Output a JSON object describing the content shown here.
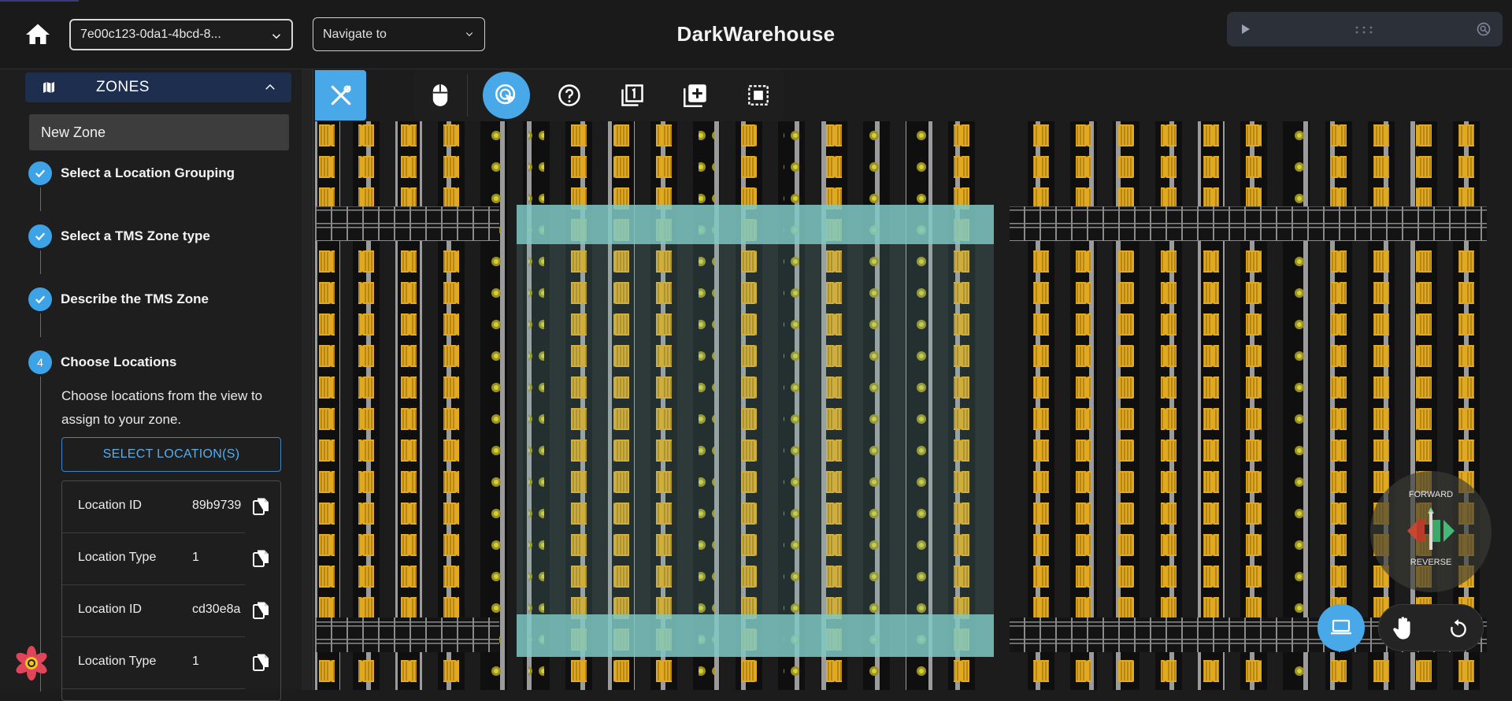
{
  "header": {
    "app_title": "DarkWarehouse",
    "warehouse_select": {
      "value": "7e00c123-0da1-4bcd-8..."
    },
    "navigate_select": {
      "value": "Navigate to"
    }
  },
  "sidebar": {
    "section_title": "ZONES",
    "zone_name": "New Zone",
    "steps": [
      {
        "number": "1",
        "label": "Select a Location Grouping",
        "state": "complete"
      },
      {
        "number": "2",
        "label": "Select a TMS Zone type",
        "state": "complete"
      },
      {
        "number": "3",
        "label": "Describe the TMS Zone",
        "state": "complete"
      },
      {
        "number": "4",
        "label": "Choose Locations",
        "state": "active"
      }
    ],
    "step4_description": "Choose locations from the view to assign to your zone.",
    "select_button_label": "SELECT LOCATION(S)",
    "locations": [
      {
        "key": "Location ID",
        "value": "89b9739"
      },
      {
        "key": "Location Type",
        "value": "1"
      },
      {
        "key": "Location ID",
        "value": "cd30e8a"
      },
      {
        "key": "Location Type",
        "value": "1"
      }
    ]
  },
  "toolbar": {
    "tools": [
      "tools-icon",
      "mouse-icon",
      "select-cursor-icon",
      "help-icon",
      "layer-one-icon",
      "add-box-icon",
      "select-area-icon"
    ]
  },
  "map_overlay": {
    "compass_forward": "FORWARD",
    "compass_reverse": "REVERSE"
  },
  "colors": {
    "accent": "#49a8e8",
    "bin_yellow": "#e1a91f",
    "selection_teal": "#7fc9c4",
    "background": "#1c1c1c"
  }
}
